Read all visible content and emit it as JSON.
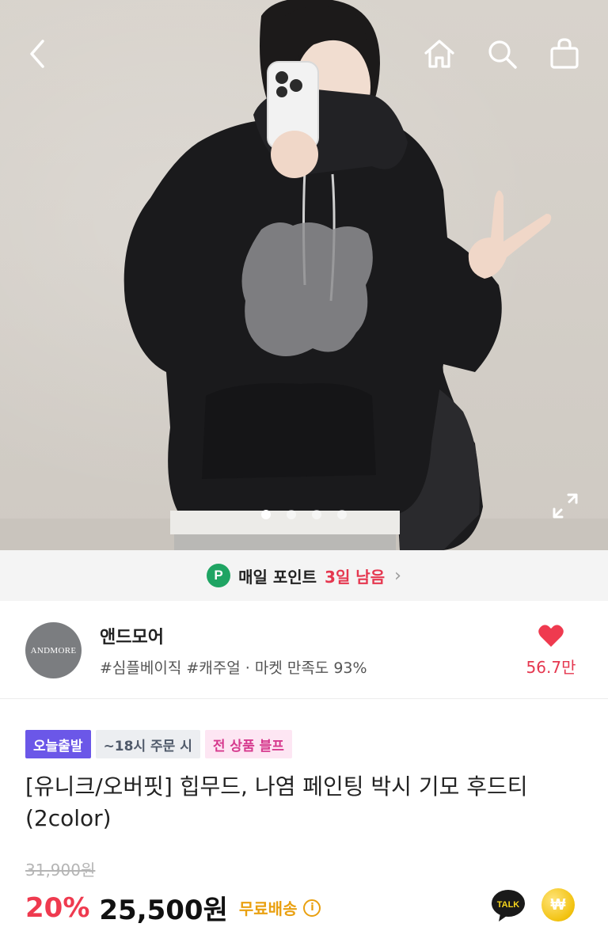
{
  "hero": {
    "image_desc": "hero-product-photo",
    "carousel_count": 4,
    "carousel_active_index": 0
  },
  "nav_icons": {
    "back": "chevron-left-icon",
    "home": "home-icon",
    "search": "search-icon",
    "cart": "shopping-bag-icon",
    "expand": "expand-icon"
  },
  "point_banner": {
    "badge": "P",
    "text": "매일 포인트",
    "days_left": "3일 남음",
    "chevron": "›",
    "badge_color": "#1fa463",
    "highlight_color": "#e5374f"
  },
  "store": {
    "logo_text": "ANDMORE",
    "name": "앤드모어",
    "tags": "#심플베이직 #캐주얼 · 마켓 만족도 93%",
    "favorite_count": "56.7만",
    "heart_color": "#ef3a4f"
  },
  "product": {
    "badges": [
      "오늘출발",
      "~18시 주문 시",
      "전 상품 블프"
    ],
    "title": "[유니크/오버핏] 힙무드, 나염 페인팅 박시 기모 후드티 (2color)",
    "original_price": "31,900원",
    "discount": "20%",
    "price": "25,500원",
    "shipping": "무료배송",
    "info_icon": "i",
    "talk_label": "TALK",
    "coin_symbol": "₩"
  },
  "colors": {
    "discount": "#ef3a4f",
    "shipping": "#e9a010",
    "badge_purple": "#6b57e8",
    "badge_pink_text": "#d63a8e"
  }
}
